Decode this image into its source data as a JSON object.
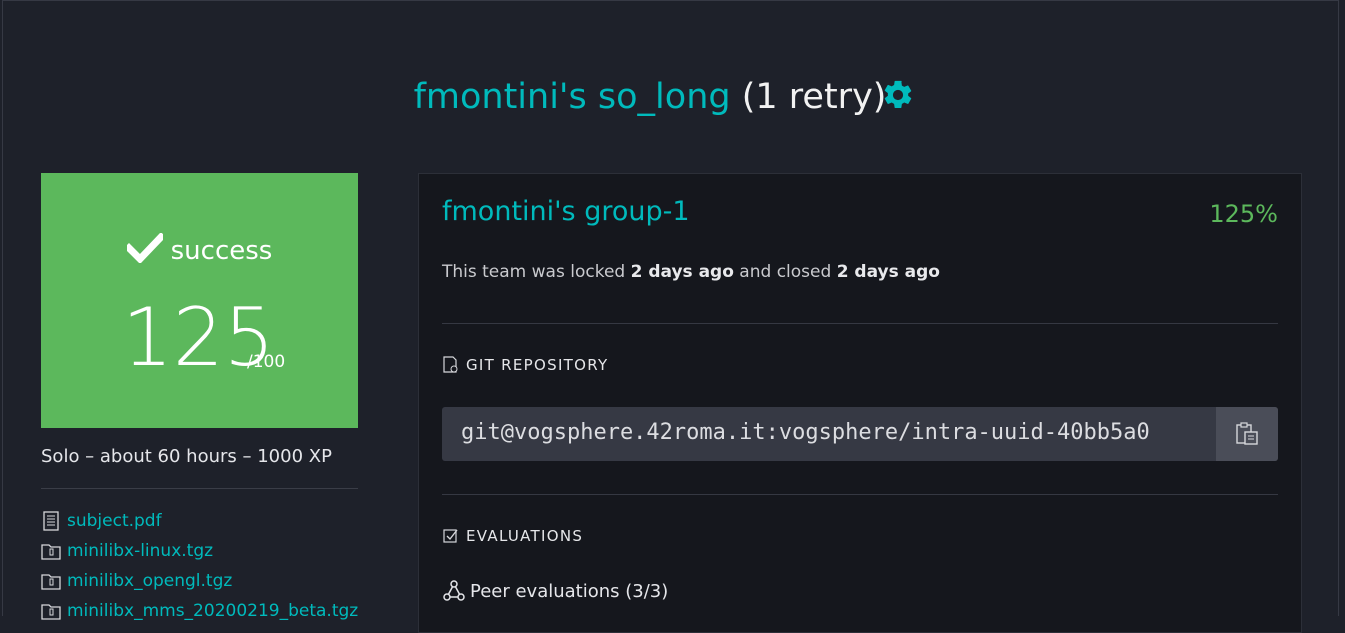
{
  "header": {
    "name_part": "fmontini's so_long",
    "retry_part": "(1 retry)",
    "settings_icon": "gear-icon",
    "accent": "#00babc"
  },
  "score_box": {
    "status": "success",
    "score": "125",
    "max": "/100",
    "color": "#5cb85c"
  },
  "project_meta": "Solo – about 60 hours – 1000 XP",
  "attachments": [
    {
      "label": "subject.pdf",
      "icon": "document-icon"
    },
    {
      "label": "minilibx-linux.tgz",
      "icon": "archive-icon"
    },
    {
      "label": "minilibx_opengl.tgz",
      "icon": "archive-icon"
    },
    {
      "label": "minilibx_mms_20200219_beta.tgz",
      "icon": "archive-icon"
    }
  ],
  "team": {
    "title": "fmontini's group-1",
    "score": "125%",
    "info_prefix": "This team was locked ",
    "locked": "2 days ago",
    "info_middle": " and closed ",
    "closed": "2 days ago"
  },
  "git": {
    "heading": "GIT REPOSITORY",
    "url": "git@vogsphere.42roma.it:vogsphere/intra-uuid-40bb5a0",
    "copy_icon": "clipboard-icon"
  },
  "evaluations": {
    "heading": "EVALUATIONS",
    "peer_label": "Peer evaluations (3/3)"
  }
}
